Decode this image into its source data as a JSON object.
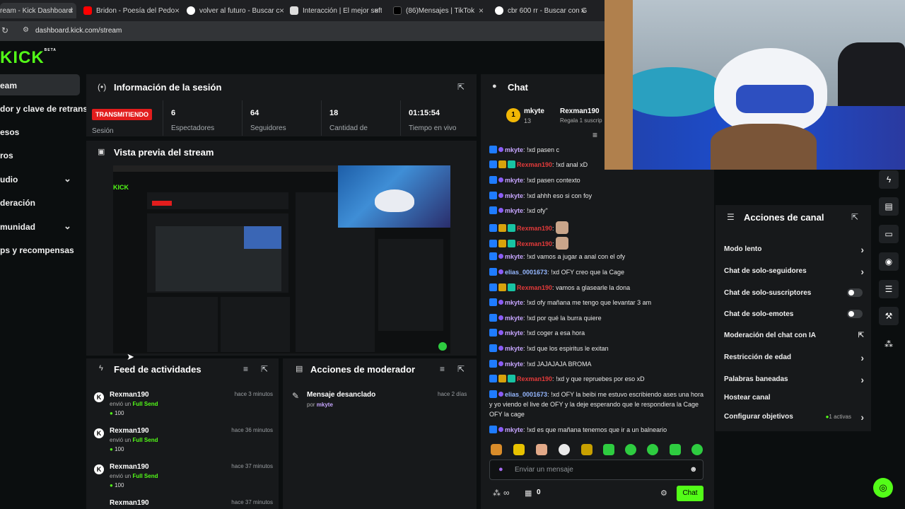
{
  "browser": {
    "tabs": [
      {
        "title": "ream - Kick Dashboard",
        "active": true
      },
      {
        "title": "Bridon - Poesía del Pedo"
      },
      {
        "title": "volver al futuro - Buscar c"
      },
      {
        "title": "Interacción | El mejor soft"
      },
      {
        "title": "(86)Mensajes | TikTok"
      },
      {
        "title": "cbr 600 rr - Buscar con G"
      }
    ],
    "url": "dashboard.kick.com/stream"
  },
  "logo": {
    "text": "KICK",
    "beta": "BETA"
  },
  "sidebar": {
    "items": [
      {
        "label": "eam",
        "active": true
      },
      {
        "label": "dor y clave de retransm"
      },
      {
        "label": "esos"
      },
      {
        "label": "ros"
      },
      {
        "label": "udio",
        "expandable": true
      },
      {
        "label": "deración"
      },
      {
        "label": "munidad",
        "expandable": true
      },
      {
        "label": "ps y recompensas"
      }
    ]
  },
  "session": {
    "title": "Información de la sesión",
    "status": "TRANSMITIENDO",
    "status_label": "Sesión",
    "stats": [
      {
        "value": "6",
        "label": "Espectadores"
      },
      {
        "value": "64",
        "label": "Seguidores"
      },
      {
        "value": "18",
        "label": "Cantidad de"
      },
      {
        "value": "01:15:54",
        "label": "Tiempo en vivo"
      }
    ]
  },
  "preview": {
    "title": "Vista previa del stream"
  },
  "feed": {
    "title": "Feed de actividades",
    "items": [
      {
        "user": "Rexman190",
        "action": "envió un",
        "item": "Full Send",
        "amount": "100",
        "time": "hace 3 minutos"
      },
      {
        "user": "Rexman190",
        "action": "envió un",
        "item": "Full Send",
        "amount": "100",
        "time": "hace 36 minutos"
      },
      {
        "user": "Rexman190",
        "action": "envió un",
        "item": "Full Send",
        "amount": "100",
        "time": "hace 37 minutos"
      },
      {
        "user": "Rexman190",
        "action": "",
        "item": "",
        "amount": "",
        "time": "hace 37 minutos"
      }
    ]
  },
  "modactions": {
    "title": "Acciones de moderador",
    "items": [
      {
        "action": "Mensaje desanclado",
        "by_prefix": "por",
        "by": "mkyte",
        "time": "hace 2 días"
      }
    ]
  },
  "chat": {
    "title": "Chat",
    "pinned": {
      "user": "mkyte",
      "count": "13",
      "gifter": "Rexman190",
      "gift_text": "Regala 1 suscrip"
    },
    "messages": [
      {
        "user": "mkyte",
        "color": "purple",
        "text": "!xd pasen c",
        "badges": [
          "blue",
          "purple"
        ]
      },
      {
        "user": "Rexman190",
        "color": "red",
        "text": "!xd anal xD",
        "badges": [
          "blue",
          "gold",
          "teal"
        ]
      },
      {
        "user": "mkyte",
        "color": "purple",
        "text": "!xd pasen contexto",
        "badges": [
          "blue",
          "purple"
        ]
      },
      {
        "user": "mkyte",
        "color": "purple",
        "text": "!xd ahhh eso si con foy",
        "badges": [
          "blue",
          "purple"
        ]
      },
      {
        "user": "mkyte",
        "color": "purple",
        "text": "!xd ofy\"",
        "badges": [
          "blue",
          "purple"
        ]
      },
      {
        "user": "Rexman190",
        "color": "red",
        "text": "",
        "badges": [
          "blue",
          "gold",
          "teal"
        ]
      },
      {
        "user": "Rexman190",
        "color": "red",
        "text": "",
        "badges": [
          "blue",
          "gold",
          "teal"
        ]
      },
      {
        "user": "mkyte",
        "color": "purple",
        "text": "!xd vamos a jugar a anal con el ofy",
        "badges": [
          "blue",
          "purple"
        ]
      },
      {
        "user": "elias_0001673",
        "color": "blue",
        "text": "!xd OFY creo que la Cage",
        "badges": [
          "blue",
          "purple"
        ]
      },
      {
        "user": "Rexman190",
        "color": "red",
        "text": "vamos a glasearle la dona",
        "badges": [
          "blue",
          "gold",
          "teal"
        ]
      },
      {
        "user": "mkyte",
        "color": "purple",
        "text": "!xd ofy mañana me tengo que levantar 3 am",
        "badges": [
          "blue",
          "purple"
        ]
      },
      {
        "user": "mkyte",
        "color": "purple",
        "text": "!xd por qué la burra quiere",
        "badges": [
          "blue",
          "purple"
        ]
      },
      {
        "user": "mkyte",
        "color": "purple",
        "text": "!xd coger a esa hora",
        "badges": [
          "blue",
          "purple"
        ]
      },
      {
        "user": "mkyte",
        "color": "purple",
        "text": "!xd que los espiritus le exitan",
        "badges": [
          "blue",
          "purple"
        ]
      },
      {
        "user": "mkyte",
        "color": "purple",
        "text": "!xd JAJAJAJA BROMA",
        "badges": [
          "blue",
          "purple"
        ]
      },
      {
        "user": "Rexman190",
        "color": "red",
        "text": "!xd y que repruebes por eso xD",
        "badges": [
          "blue",
          "gold",
          "teal"
        ]
      },
      {
        "user": "elias_0001673",
        "color": "blue",
        "text": "!xd OFY la beibi me estuvo escribiendo ases una hora y yo viendo el live de OFY y la deje esperando que le respondiera la Cage OFY la cage",
        "badges": [
          "blue",
          "purple"
        ]
      },
      {
        "user": "mkyte",
        "color": "purple",
        "text": "!xd es que mañana tenemos que ir a un balneario",
        "badges": [
          "blue",
          "purple"
        ]
      }
    ],
    "input_placeholder": "Enviar un mensaje",
    "points": "∞",
    "gift_count": "0",
    "send_label": "Chat"
  },
  "channel_actions": {
    "title": "Acciones de canal",
    "items": [
      {
        "label": "Modo lento",
        "control": "arrow"
      },
      {
        "label": "Chat de solo-seguidores",
        "control": "arrow"
      },
      {
        "label": "Chat de solo-suscriptores",
        "control": "toggle"
      },
      {
        "label": "Chat de solo-emotes",
        "control": "toggle"
      },
      {
        "label": "Moderación del chat con IA",
        "control": "external"
      },
      {
        "label": "Restricción de edad",
        "control": "arrow"
      },
      {
        "label": "Palabras baneadas",
        "control": "arrow"
      },
      {
        "label": "Hostear canal",
        "control": "none"
      },
      {
        "label": "Configurar objetivos",
        "control": "arrow",
        "extra": "1 activas"
      }
    ]
  },
  "colors": {
    "brand": "#53fc18",
    "live": "#e21d1d",
    "panel": "#17191b",
    "bg": "#0b0e0f"
  }
}
